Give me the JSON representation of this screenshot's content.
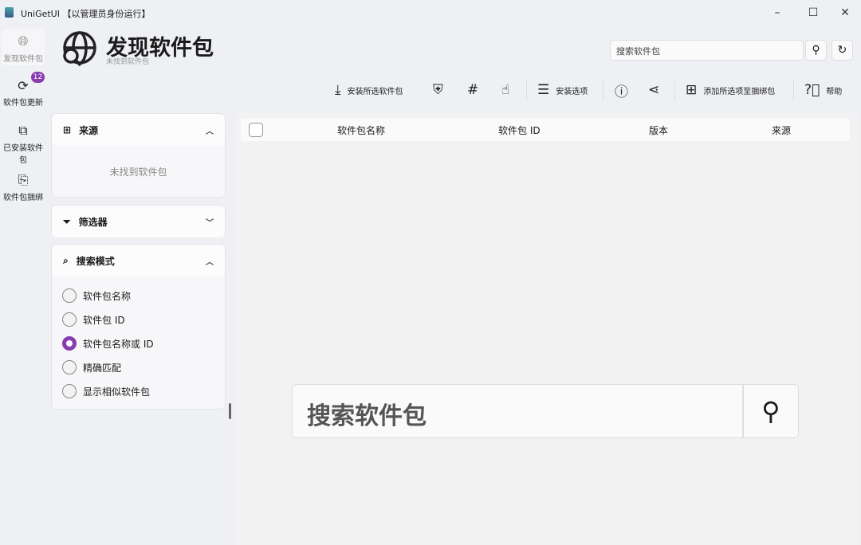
{
  "window": {
    "title": "UniGetUI 【以管理员身份运行】",
    "minimize": "–",
    "maximize": "☐",
    "close": "✕"
  },
  "nav": [
    {
      "label": "发现软件包",
      "icon": "globe-icon"
    },
    {
      "label": "软件包更新",
      "icon": "refresh-icon",
      "badge": "12"
    },
    {
      "label": "已安装软件包",
      "icon": "installed-icon"
    },
    {
      "label": "软件包捆绑",
      "icon": "bundle-icon"
    }
  ],
  "header": {
    "title": "发现软件包",
    "subtitle": "未找到软件包"
  },
  "search": {
    "placeholder": "搜索软件包",
    "big_placeholder": "搜索软件包"
  },
  "toolbar": {
    "install": "安装所选软件包",
    "options": "安装选项",
    "add_bundle": "添加所选项至捆绑包",
    "help": "帮助"
  },
  "sources": {
    "title": "来源",
    "empty": "未找到软件包"
  },
  "filters": {
    "title": "筛选器"
  },
  "search_mode": {
    "title": "搜索模式",
    "options": [
      "软件包名称",
      "软件包 ID",
      "软件包名称或 ID",
      "精确匹配",
      "显示相似软件包"
    ],
    "selected": 2
  },
  "table": {
    "columns": [
      "软件包名称",
      "软件包 ID",
      "版本",
      "来源"
    ]
  },
  "colors": {
    "accent": "#8a3bb0"
  }
}
